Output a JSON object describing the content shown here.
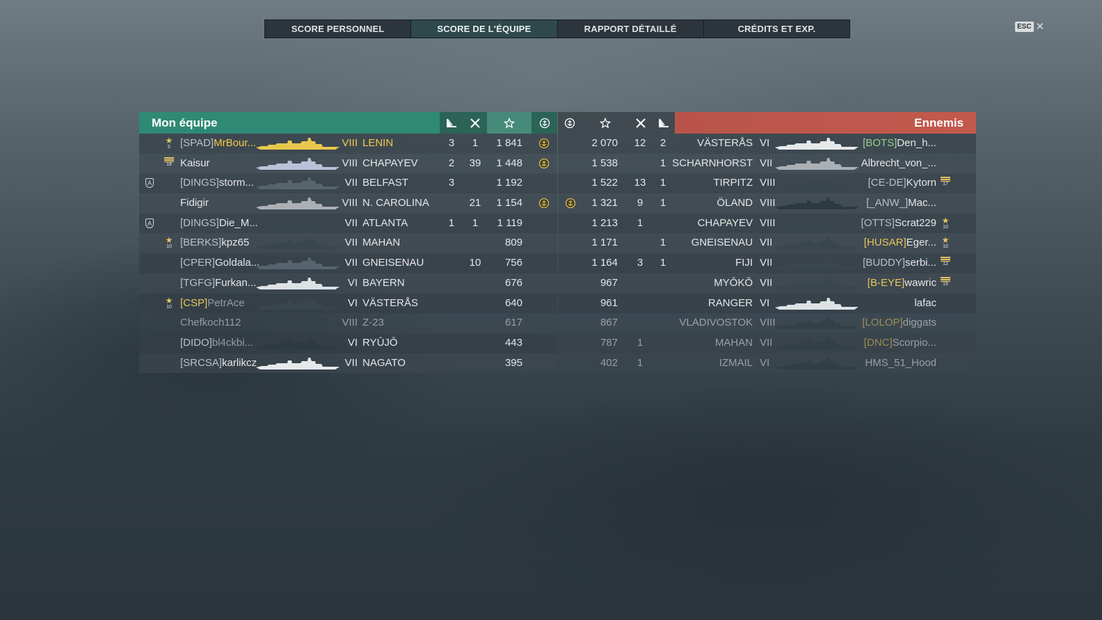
{
  "tabs": [
    "SCORE PERSONNEL",
    "SCORE DE L'ÉQUIPE",
    "RAPPORT DÉTAILLÉ",
    "CRÉDITS ET EXP."
  ],
  "active_tab": 1,
  "close": {
    "key": "ESC",
    "icon": "close-icon"
  },
  "colors": {
    "ally": "#2f8a74",
    "enemy": "#c25a4d",
    "highlight": "#f2cc4a"
  },
  "left_team": {
    "title": "Mon équipe",
    "rows": [
      {
        "clan": "[SPAD]",
        "name": "MrBour...",
        "tier": "VIII",
        "ship": "LENIN",
        "kills": "3",
        "planes": "1",
        "score": "1 841",
        "medal": true,
        "badge": {
          "type": "star",
          "num": "5"
        },
        "highlight": true,
        "silhouette_color": "#e8c84c"
      },
      {
        "clan": "",
        "name": "Kaisur",
        "tier": "VIII",
        "ship": "CHAPAYEV",
        "kills": "2",
        "planes": "39",
        "score": "1 448",
        "medal": true,
        "badge": {
          "type": "stripes",
          "num": "18"
        },
        "silhouette_color": "#b9c2d8"
      },
      {
        "clan": "[DINGS]",
        "name": "storm...",
        "tier": "VII",
        "ship": "BELFAST",
        "kills": "3",
        "planes": "",
        "score": "1 192",
        "division": "A",
        "silhouette_color": "#56646d"
      },
      {
        "clan": "",
        "name": "Fidigir",
        "tier": "VIII",
        "ship": "N. CAROLINA",
        "kills": "",
        "planes": "21",
        "score": "1 154",
        "medal": true,
        "silhouette_color": "#aab0b4"
      },
      {
        "clan": "[DINGS]",
        "name": "Die_M...",
        "tier": "VII",
        "ship": "ATLANTA",
        "kills": "1",
        "planes": "1",
        "score": "1 119",
        "division": "A",
        "silhouette_color": "#3a464e"
      },
      {
        "clan": "[BERKS]",
        "name": "kpz65",
        "tier": "VII",
        "ship": "MAHAN",
        "kills": "",
        "planes": "",
        "score": "809",
        "badge": {
          "type": "star",
          "num": "10"
        },
        "silhouette_color": "#3a464e"
      },
      {
        "clan": "[CPER]",
        "name": "Goldala...",
        "tier": "VII",
        "ship": "GNEISENAU",
        "kills": "",
        "planes": "10",
        "score": "756",
        "silhouette_color": "#56646d"
      },
      {
        "clan": "[TGFG]",
        "name": "Furkan...",
        "tier": "VI",
        "ship": "BAYERN",
        "kills": "",
        "planes": "",
        "score": "676",
        "silhouette_color": "#dde2e4"
      },
      {
        "clan": "[CSP]",
        "name": "PetrAce",
        "tier": "VI",
        "ship": "VÄSTERÅS",
        "kills": "",
        "planes": "",
        "score": "640",
        "badge": {
          "type": "star",
          "num": "10"
        },
        "clan_gold": true,
        "faded_name": true,
        "silhouette_color": "#3a464e"
      },
      {
        "clan": "",
        "name": "Chefkoch112",
        "tier": "VIII",
        "ship": "Z-23",
        "kills": "",
        "planes": "",
        "score": "617",
        "faded": true,
        "silhouette_color": "#3a464e"
      },
      {
        "clan": "[DIDO]",
        "name": "bl4ckbi...",
        "tier": "VI",
        "ship": "RYŪJŌ",
        "kills": "",
        "planes": "",
        "score": "443",
        "faded_name": true,
        "silhouette_color": "#2e3a42"
      },
      {
        "clan": "[SRCSA]",
        "name": "karlikcz",
        "tier": "VII",
        "ship": "NAGATO",
        "kills": "",
        "planes": "",
        "score": "395",
        "silhouette_color": "#e6e9ea"
      }
    ]
  },
  "right_team": {
    "title": "Ennemis",
    "rows": [
      {
        "score": "2 070",
        "planes": "12",
        "kills": "2",
        "ship": "VÄSTERÅS",
        "tier": "VI",
        "clan": "[BOTS]",
        "name": "Den_h...",
        "clan_color": "green",
        "silhouette_color": "#e6e9ea"
      },
      {
        "score": "1 538",
        "planes": "",
        "kills": "1",
        "ship": "SCHARNHORST",
        "tier": "VII",
        "clan": "",
        "name": "Albrecht_von_...",
        "silhouette_color": "#aab0b4"
      },
      {
        "score": "1 522",
        "planes": "13",
        "kills": "1",
        "ship": "TIRPITZ",
        "tier": "VIII",
        "clan": "[CE-DE]",
        "name": "Kytorn",
        "badge": {
          "type": "stripes",
          "num": "17"
        },
        "silhouette_color": "#3a464e"
      },
      {
        "score": "1 321",
        "planes": "9",
        "kills": "1",
        "ship": "ÖLAND",
        "tier": "VIII",
        "clan": "[_ANW_]",
        "name": "Mac...",
        "medal": true,
        "silhouette_color": "#2e3a42"
      },
      {
        "score": "1 213",
        "planes": "1",
        "kills": "",
        "ship": "CHAPAYEV",
        "tier": "VIII",
        "clan": "[OTTS]",
        "name": "Scrat229",
        "badge": {
          "type": "star",
          "num": "10"
        },
        "silhouette_color": "#3a464e"
      },
      {
        "score": "1 171",
        "planes": "",
        "kills": "1",
        "ship": "GNEISENAU",
        "tier": "VII",
        "clan": "[HUSAR]",
        "name": "Eger...",
        "clan_color": "gold",
        "badge": {
          "type": "star",
          "num": "10"
        },
        "silhouette_color": "#3a464e"
      },
      {
        "score": "1 164",
        "planes": "3",
        "kills": "1",
        "ship": "FIJI",
        "tier": "VII",
        "clan": "[BUDDY]",
        "name": "serbi...",
        "badge": {
          "type": "stripes",
          "num": "12"
        },
        "silhouette_color": "#3a464e"
      },
      {
        "score": "967",
        "planes": "",
        "kills": "",
        "ship": "MYŌKŌ",
        "tier": "VII",
        "clan": "[B-EYE]",
        "name": "wawric",
        "clan_color": "gold",
        "badge": {
          "type": "stripes",
          "num": "15"
        },
        "silhouette_color": "#3a464e"
      },
      {
        "score": "961",
        "planes": "",
        "kills": "",
        "ship": "RANGER",
        "tier": "VI",
        "clan": "",
        "name": "lafac",
        "silhouette_color": "#dde2e4"
      },
      {
        "score": "867",
        "planes": "",
        "kills": "",
        "ship": "VLADIVOSTOK",
        "tier": "VIII",
        "clan": "[LOLOP]",
        "name": "diggats",
        "clan_color": "gold",
        "faded": true,
        "silhouette_color": "#2e3a42"
      },
      {
        "score": "787",
        "planes": "1",
        "kills": "",
        "ship": "MAHAN",
        "tier": "VII",
        "clan": "[DNC]",
        "name": "Scorpio...",
        "clan_color": "gold",
        "faded": true,
        "silhouette_color": "#2e3a42"
      },
      {
        "score": "402",
        "planes": "1",
        "kills": "",
        "ship": "IZMAIL",
        "tier": "VI",
        "clan": "",
        "name": "HMS_51_Hood",
        "faded": true,
        "silhouette_color": "#2e3a42"
      }
    ]
  }
}
